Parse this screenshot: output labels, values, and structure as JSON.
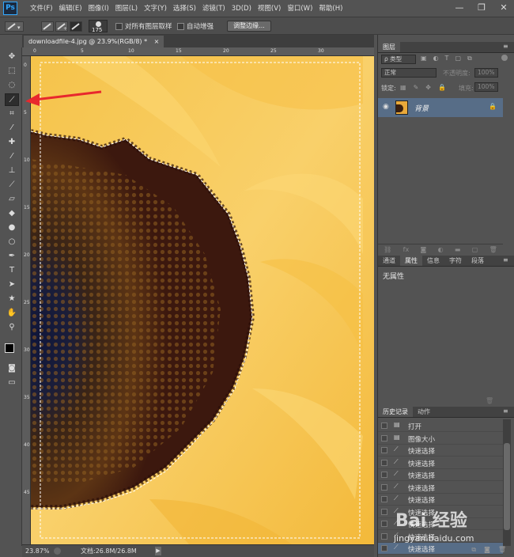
{
  "app": {
    "logo": "Ps"
  },
  "menu": [
    "文件(F)",
    "编辑(E)",
    "图像(I)",
    "图层(L)",
    "文字(Y)",
    "选择(S)",
    "滤镜(T)",
    "3D(D)",
    "视图(V)",
    "窗口(W)",
    "帮助(H)"
  ],
  "window_controls": {
    "minimize": "—",
    "restore": "❐",
    "close": "✕"
  },
  "options_bar": {
    "brush_size": "175",
    "sample_all_layers": "对所有图层取样",
    "auto_enhance": "自动增强",
    "refine_edge_button": "调整边缘..."
  },
  "document_tab": {
    "title": "downloadfile-4.jpg @ 23.9%(RGB/8) *",
    "close": "×"
  },
  "status_bar": {
    "zoom": "23.87%",
    "doc_info": "文档:26.8M/26.8M"
  },
  "ruler_top_ticks": [
    "0",
    "5",
    "10",
    "15",
    "20",
    "25",
    "30"
  ],
  "ruler_left_ticks": [
    "0",
    "5",
    "10",
    "15",
    "20",
    "25",
    "30",
    "35",
    "40",
    "45"
  ],
  "layers_panel": {
    "tab": "图层",
    "filter_label": "ρ 类型",
    "blend_mode": "正常",
    "opacity_label": "不透明度:",
    "opacity_value": "100%",
    "lock_label": "锁定:",
    "fill_label": "填充:",
    "fill_value": "100%",
    "layers": [
      {
        "name": "背景",
        "locked": true
      }
    ]
  },
  "properties_panel": {
    "tabs": [
      "通道",
      "属性",
      "信息",
      "字符",
      "段落"
    ],
    "active_tab": "属性",
    "content": "无属性"
  },
  "history_panel": {
    "tabs": [
      "历史记录",
      "动作"
    ],
    "items": [
      "打开",
      "图像大小",
      "快速选择",
      "快速选择",
      "快速选择",
      "快速选择",
      "快速选择",
      "快速选择",
      "快速选择",
      "快速选择",
      "快速选择"
    ]
  },
  "watermark": {
    "text": "Bai 经验",
    "url": "jingyan.baidu.com"
  },
  "colors": {
    "accent": "#31a8ff",
    "layer_selected": "#576d87",
    "arrow": "#e8282d"
  }
}
